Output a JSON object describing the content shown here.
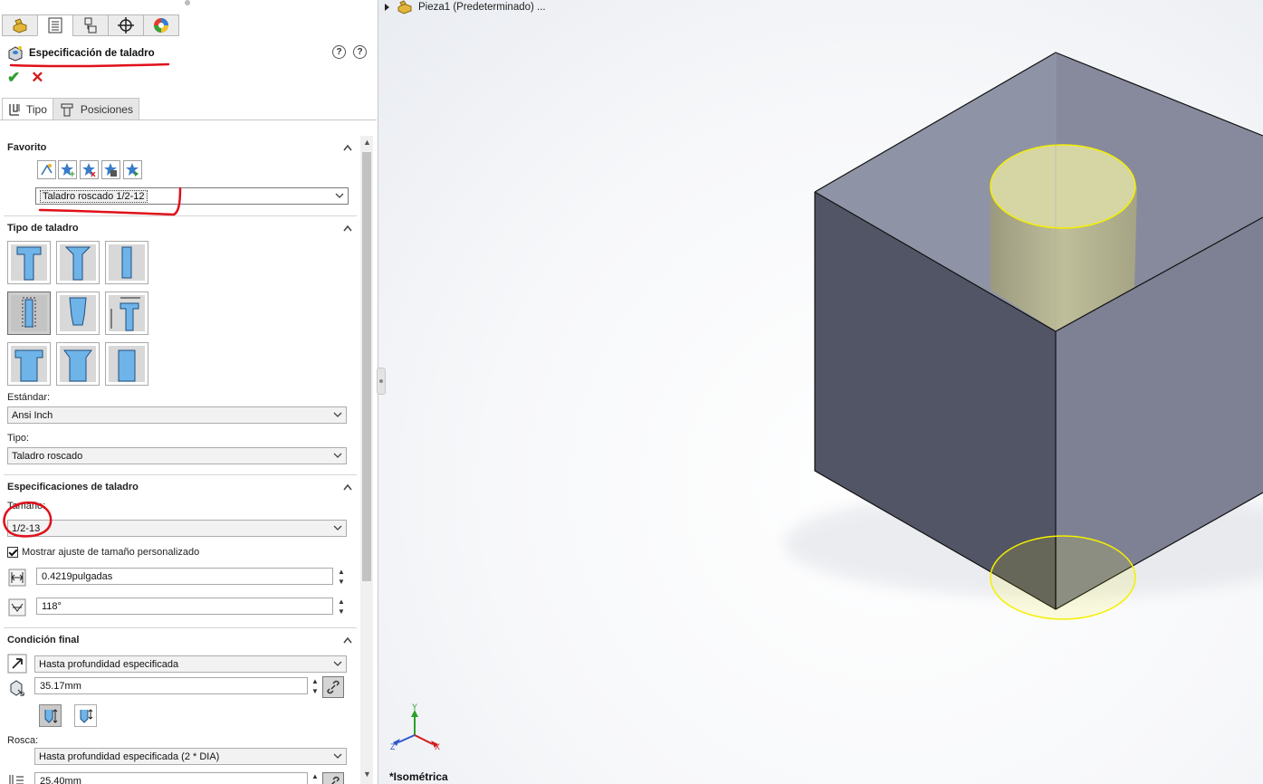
{
  "manager_tabs": [
    {
      "icon": "feature-manager-icon"
    },
    {
      "icon": "property-manager-icon"
    },
    {
      "icon": "configuration-manager-icon"
    },
    {
      "icon": "dimxpert-manager-icon"
    },
    {
      "icon": "display-manager-icon"
    }
  ],
  "title": "Especificación de taladro",
  "subtabs": {
    "tipo": "Tipo",
    "posiciones": "Posiciones"
  },
  "favorito": {
    "heading": "Favorito",
    "value": "Taladro roscado 1/2-12"
  },
  "tipo_taladro": {
    "heading": "Tipo de taladro",
    "selected_index": 3
  },
  "estandar": {
    "label": "Estándar:",
    "value": "Ansi Inch"
  },
  "tipo": {
    "label": "Tipo:",
    "value": "Taladro roscado"
  },
  "especificaciones": {
    "heading": "Especificaciones de taladro",
    "tamano_label": "Tamaño:",
    "tamano_value": "1/2-13",
    "custom_label": "Mostrar ajuste de tamaño personalizado",
    "diameter_value": "0.4219pulgadas",
    "angle_value": "118°"
  },
  "condicion": {
    "heading": "Condición final",
    "value": "Hasta profundidad especificada",
    "depth_value": "35.17mm"
  },
  "rosca": {
    "label": "Rosca:",
    "value": "Hasta profundidad especificada (2 * DIA)",
    "depth_value": "25.40mm"
  },
  "graphics": {
    "tree_item": "Pieza1  (Predeterminado) ...",
    "view_name": "*Isométrica",
    "axes": {
      "x": "X",
      "y": "Y",
      "z": "Z"
    }
  },
  "colors": {
    "annotation_red": "#e0101a",
    "face_top": "#8f93a6",
    "face_left": "#525566",
    "face_right": "#7e8194",
    "hole_highlight": "#f4f000"
  }
}
